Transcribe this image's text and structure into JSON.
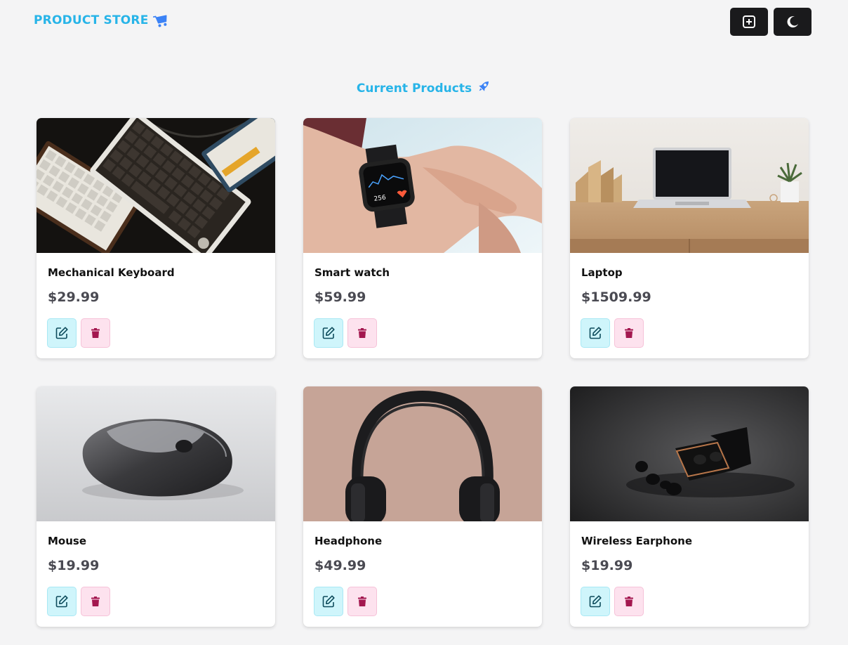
{
  "navbar": {
    "brand": "PRODUCT STORE",
    "brand_icon": "shopping-cart-icon",
    "actions": [
      {
        "icon": "plus-square-icon"
      },
      {
        "icon": "moon-icon"
      }
    ]
  },
  "section": {
    "title": "Current Products",
    "icon": "rocket-icon"
  },
  "products": [
    {
      "name": "Mechanical Keyboard",
      "price": "$29.99",
      "image": "keyboard-photo"
    },
    {
      "name": "Smart watch",
      "price": "$59.99",
      "image": "smartwatch-photo"
    },
    {
      "name": "Laptop",
      "price": "$1509.99",
      "image": "laptop-photo"
    },
    {
      "name": "Mouse",
      "price": "$19.99",
      "image": "mouse-photo"
    },
    {
      "name": "Headphone",
      "price": "$49.99",
      "image": "headphone-photo"
    },
    {
      "name": "Wireless Earphone",
      "price": "$19.99",
      "image": "earphone-photo"
    }
  ],
  "colors": {
    "accent": "#27b4e8",
    "icon_blue": "#3b82f6",
    "edit_bg": "#cff5fb",
    "edit_icon": "#0e4c5c",
    "delete_bg": "#fde2ee",
    "delete_icon": "#a3174f",
    "nav_button": "#1a1a1c"
  }
}
